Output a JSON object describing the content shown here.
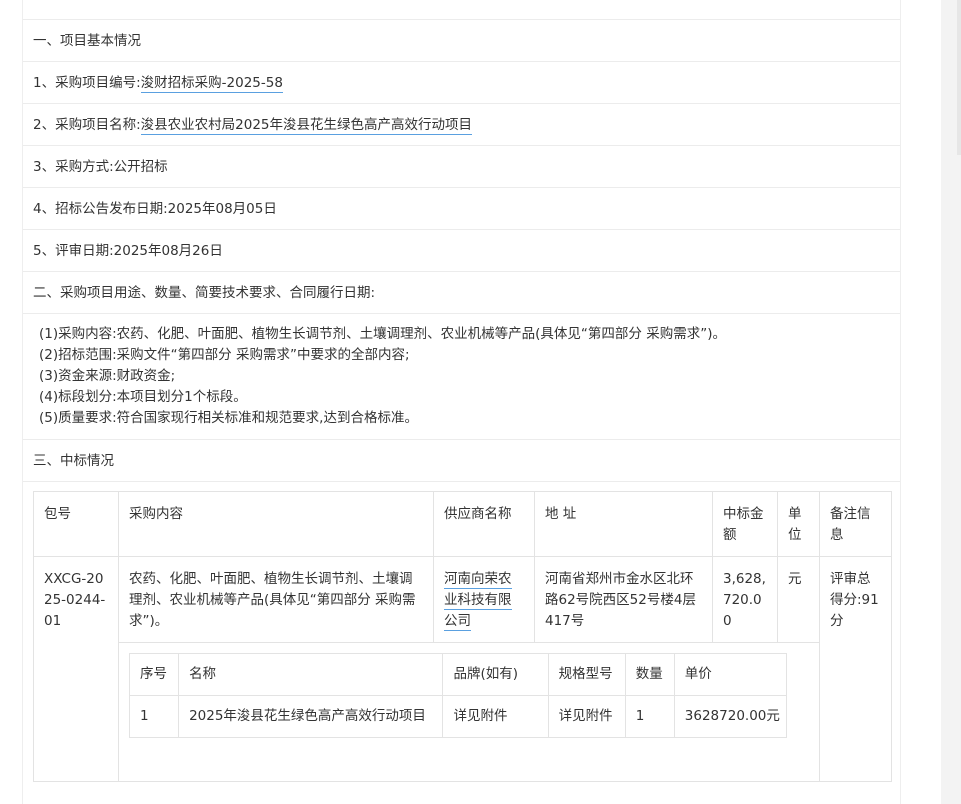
{
  "sections": {
    "s1_title": "一、项目基本情况",
    "s2_title": "二、采购项目用途、数量、简要技术要求、合同履行日期:",
    "s3_title": "三、中标情况"
  },
  "basic": {
    "project_no_label": "1、采购项目编号:",
    "project_no": "浚财招标采购-2025-58",
    "project_name_label": "2、采购项目名称:",
    "project_name": "浚县农业农村局2025年浚县花生绿色高产高效行动项目",
    "method": "3、采购方式:公开招标",
    "announce_date": "4、招标公告发布日期:2025年08月05日",
    "review_date": "5、评审日期:2025年08月26日"
  },
  "requirements": [
    "(1)采购内容:农药、化肥、叶面肥、植物生长调节剂、土壤调理剂、农业机械等产品(具体见“第四部分 采购需求”)。",
    "(2)招标范围:采购文件“第四部分 采购需求”中要求的全部内容;",
    "(3)资金来源:财政资金;",
    "(4)标段划分:本项目划分1个标段。",
    "(5)质量要求:符合国家现行相关标准和规范要求,达到合格标准。"
  ],
  "award_table": {
    "headers": [
      "包号",
      "采购内容",
      "供应商名称",
      "地 址",
      "中标金额",
      "单位",
      "备注信息"
    ],
    "row": {
      "package": "XXCG-2025-0244-01",
      "content": "农药、化肥、叶面肥、植物生长调节剂、土壤调理剂、农业机械等产品(具体见“第四部分 采购需求”)。",
      "supplier": "河南向荣农业科技有限公司",
      "address": "河南省郑州市金水区北环路62号院西区52号楼4层417号",
      "amount": "3,628,720.00",
      "unit": "元",
      "remark": "评审总得分:91分"
    },
    "items_headers": [
      "序号",
      "名称",
      "品牌(如有)",
      "规格型号",
      "数量",
      "单价"
    ],
    "items": [
      {
        "no": "1",
        "name": "2025年浚县花生绿色高产高效行动项目",
        "brand": "详见附件",
        "model": "详见附件",
        "qty": "1",
        "price": "3628720.00元"
      }
    ]
  }
}
